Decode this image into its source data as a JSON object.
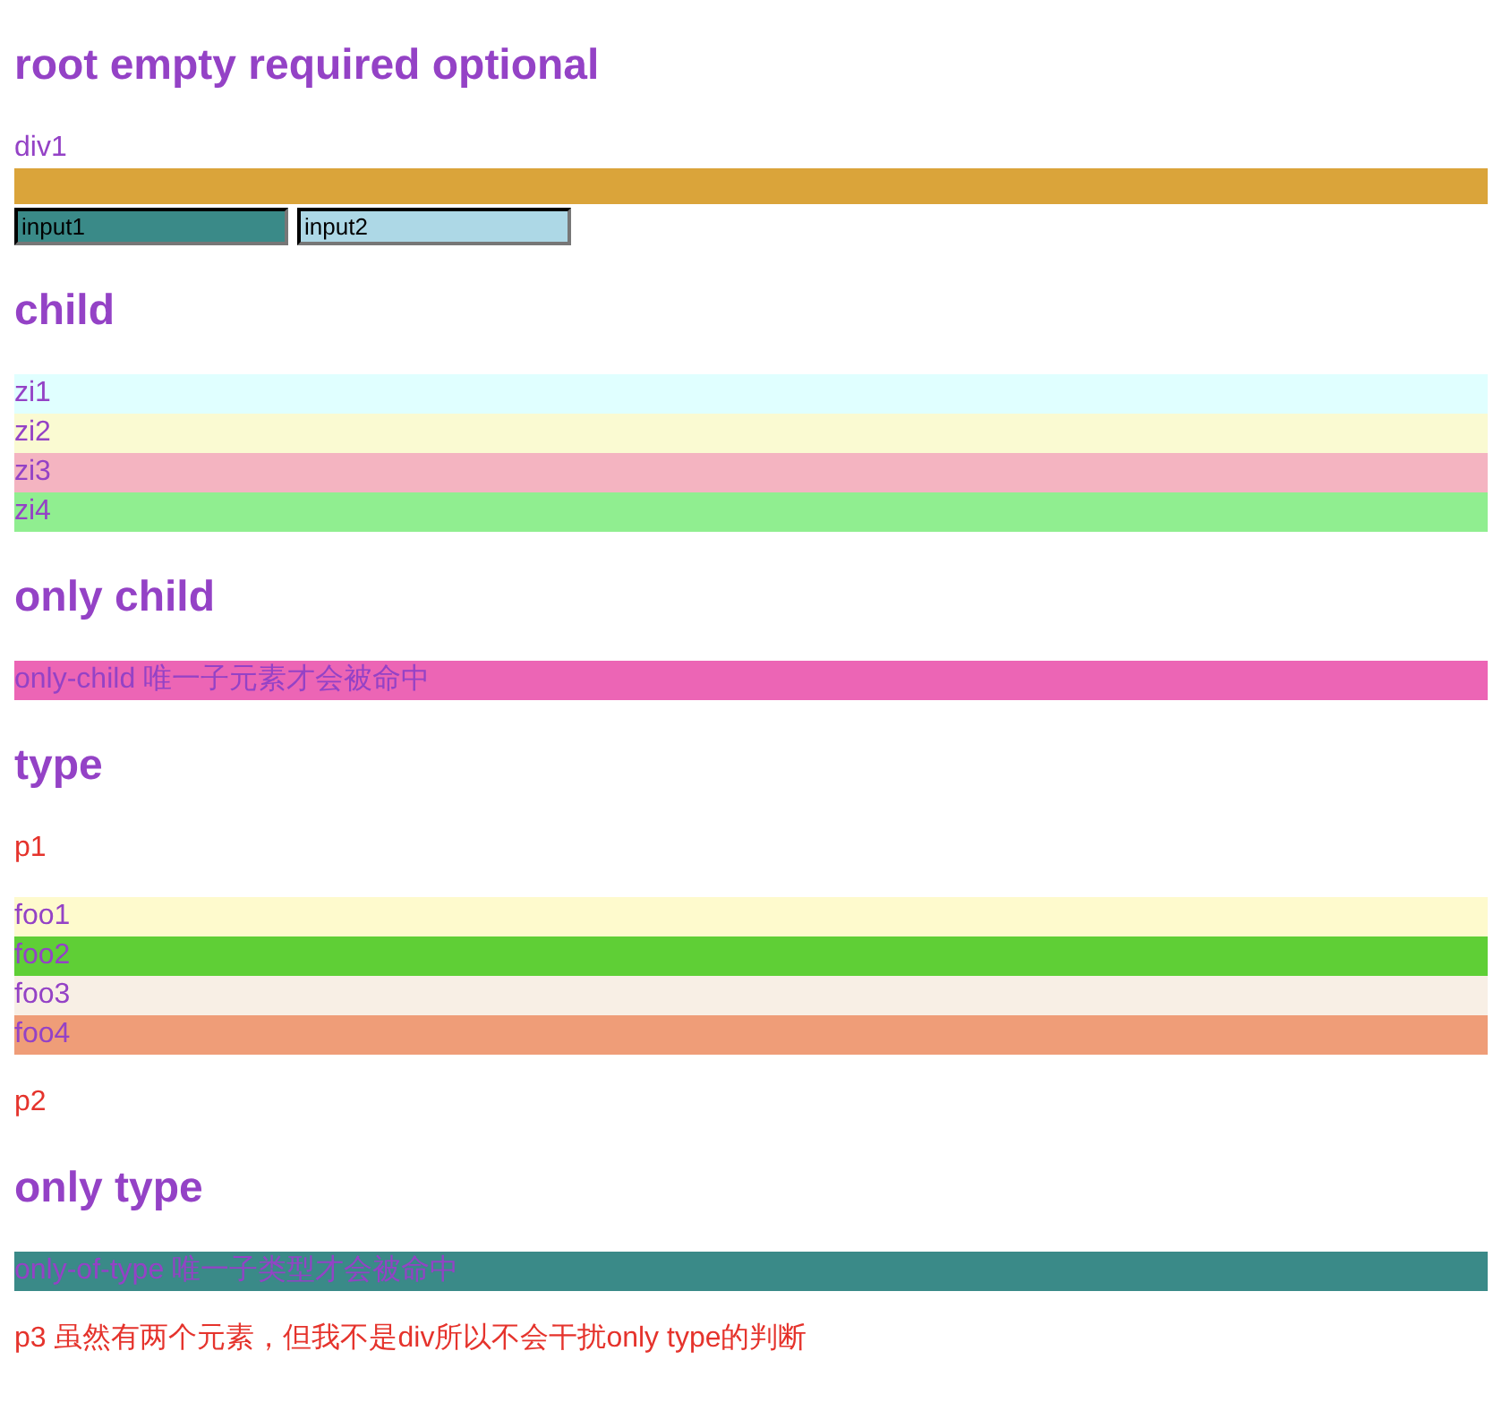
{
  "sections": [
    {
      "heading": "root empty required optional",
      "blocks": [
        {
          "kind": "row",
          "text": "div1"
        },
        {
          "kind": "bar",
          "color": "#daa43a"
        },
        {
          "kind": "inputs",
          "inputs": [
            {
              "value": "input1",
              "color": "#3a8a88"
            },
            {
              "value": "input2",
              "color": "#add8e6"
            }
          ]
        }
      ]
    },
    {
      "heading": "child",
      "blocks": [
        {
          "kind": "row",
          "text": "zi1",
          "color": "#e0ffff"
        },
        {
          "kind": "row",
          "text": "zi2",
          "color": "#fafad2"
        },
        {
          "kind": "row",
          "text": "zi3",
          "color": "#f4b4c1"
        },
        {
          "kind": "row",
          "text": "zi4",
          "color": "#90ee90"
        }
      ]
    },
    {
      "heading": "only child",
      "blocks": [
        {
          "kind": "row",
          "text": "only-child 唯一子元素才会被命中",
          "color": "#ec65b5"
        }
      ]
    },
    {
      "heading": "type",
      "blocks": [
        {
          "kind": "paragraph",
          "text": "p1"
        },
        {
          "kind": "row",
          "text": "foo1",
          "color": "#fefacd"
        },
        {
          "kind": "row",
          "text": "foo2",
          "color": "#5fcf36"
        },
        {
          "kind": "row",
          "text": "foo3",
          "color": "#f8efe5"
        },
        {
          "kind": "row",
          "text": "foo4",
          "color": "#ef9d78"
        },
        {
          "kind": "paragraph",
          "text": "p2"
        }
      ]
    },
    {
      "heading": "only type",
      "blocks": [
        {
          "kind": "row",
          "text": "only-of-type 唯一子类型才会被命中",
          "color": "#3a8a88"
        },
        {
          "kind": "paragraph",
          "text": "p3 虽然有两个元素，但我不是div所以不会干扰only type的判断"
        }
      ]
    }
  ]
}
